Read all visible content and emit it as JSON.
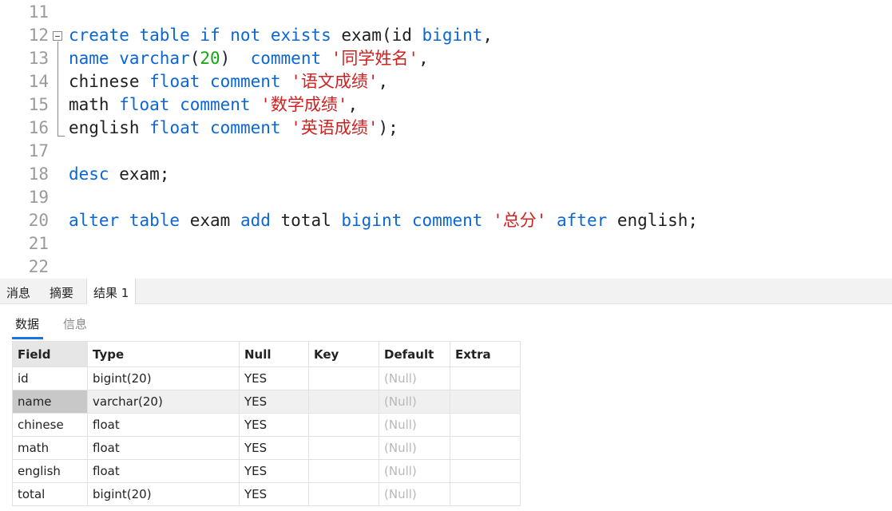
{
  "editor": {
    "lines": [
      {
        "num": "11",
        "tokens": []
      },
      {
        "num": "12",
        "tokens": [
          {
            "t": "create table if not exists",
            "c": "kw"
          },
          {
            "t": " exam(id ",
            "c": ""
          },
          {
            "t": "bigint",
            "c": "kw"
          },
          {
            "t": ",",
            "c": ""
          }
        ]
      },
      {
        "num": "13",
        "tokens": [
          {
            "t": "name varchar",
            "c": "kw"
          },
          {
            "t": "(",
            "c": ""
          },
          {
            "t": "20",
            "c": "num"
          },
          {
            "t": ")  ",
            "c": ""
          },
          {
            "t": "comment",
            "c": "kw"
          },
          {
            "t": " ",
            "c": ""
          },
          {
            "t": "'同学姓名'",
            "c": "str"
          },
          {
            "t": ",",
            "c": ""
          }
        ]
      },
      {
        "num": "14",
        "tokens": [
          {
            "t": "chinese ",
            "c": ""
          },
          {
            "t": "float comment",
            "c": "kw"
          },
          {
            "t": " ",
            "c": ""
          },
          {
            "t": "'语文成绩'",
            "c": "str"
          },
          {
            "t": ",",
            "c": ""
          }
        ]
      },
      {
        "num": "15",
        "tokens": [
          {
            "t": "math ",
            "c": ""
          },
          {
            "t": "float comment",
            "c": "kw"
          },
          {
            "t": " ",
            "c": ""
          },
          {
            "t": "'数学成绩'",
            "c": "str"
          },
          {
            "t": ",",
            "c": ""
          }
        ]
      },
      {
        "num": "16",
        "tokens": [
          {
            "t": "english ",
            "c": ""
          },
          {
            "t": "float comment",
            "c": "kw"
          },
          {
            "t": " ",
            "c": ""
          },
          {
            "t": "'英语成绩'",
            "c": "str"
          },
          {
            "t": ");",
            "c": ""
          }
        ]
      },
      {
        "num": "17",
        "tokens": []
      },
      {
        "num": "18",
        "tokens": [
          {
            "t": "desc",
            "c": "kw"
          },
          {
            "t": " exam;",
            "c": ""
          }
        ]
      },
      {
        "num": "19",
        "tokens": []
      },
      {
        "num": "20",
        "tokens": [
          {
            "t": "alter table",
            "c": "kw"
          },
          {
            "t": " exam ",
            "c": ""
          },
          {
            "t": "add",
            "c": "kw"
          },
          {
            "t": " total ",
            "c": ""
          },
          {
            "t": "bigint comment",
            "c": "kw"
          },
          {
            "t": " ",
            "c": ""
          },
          {
            "t": "'总分'",
            "c": "str"
          },
          {
            "t": " ",
            "c": ""
          },
          {
            "t": "after",
            "c": "kw"
          },
          {
            "t": " english;",
            "c": ""
          }
        ]
      },
      {
        "num": "21",
        "tokens": []
      },
      {
        "num": "22",
        "tokens": []
      }
    ]
  },
  "result_tabs": [
    {
      "label": "消息",
      "active": false
    },
    {
      "label": "摘要",
      "active": false
    },
    {
      "label": "结果 1",
      "active": true
    }
  ],
  "sub_tabs": [
    {
      "label": "数据",
      "active": true
    },
    {
      "label": "信息",
      "active": false
    }
  ],
  "table": {
    "columns": [
      "Field",
      "Type",
      "Null",
      "Key",
      "Default",
      "Extra"
    ],
    "rows": [
      [
        "id",
        "bigint(20)",
        "YES",
        "",
        "(Null)",
        ""
      ],
      [
        "name",
        "varchar(20)",
        "YES",
        "",
        "(Null)",
        ""
      ],
      [
        "chinese",
        "float",
        "YES",
        "",
        "(Null)",
        ""
      ],
      [
        "math",
        "float",
        "YES",
        "",
        "(Null)",
        ""
      ],
      [
        "english",
        "float",
        "YES",
        "",
        "(Null)",
        ""
      ],
      [
        "total",
        "bigint(20)",
        "YES",
        "",
        "(Null)",
        ""
      ]
    ],
    "selected_row": 1
  },
  "colors": {
    "keyword": "#0b66d6",
    "number": "#14a614",
    "string": "#d21f1f",
    "accent": "#1a73e8"
  }
}
